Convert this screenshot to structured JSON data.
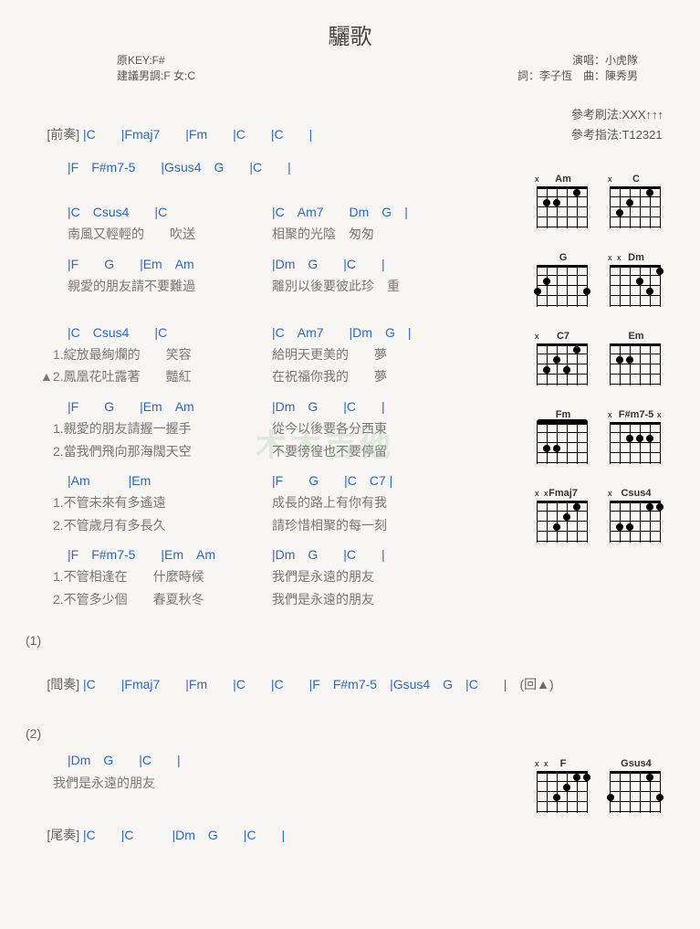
{
  "title": "驪歌",
  "meta": {
    "original_key_label": "原KEY:F#",
    "suggested_key_label": "建議男調:F 女:C",
    "singer_label": "演唱：小虎隊",
    "credits_label": "詞：李子恆　曲：陳秀男"
  },
  "reference": {
    "strum_label": "參考刷法:XXX↑↑↑",
    "finger_label": "參考指法:T12321"
  },
  "intro": {
    "label": "[前奏]",
    "line1": "|C　　|Fmaj7　　|Fm　　|C　　|C　　|",
    "line2": "|F　F#m7-5　　|Gsus4　G　　|C　　|"
  },
  "verse1": {
    "chords_a": "|C　Csus4　　|C",
    "chords_b": "|C　Am7　　Dm　G　|",
    "lyric_a": "南風又輕輕的　　吹送",
    "lyric_b": "相聚的光陰　匆匆",
    "chords_c": "|F　　G　　|Em　Am",
    "chords_d": "|Dm　G　　|C　　|",
    "lyric_c": "親愛的朋友請不要難過",
    "lyric_d": "離別以後要彼此珍　重"
  },
  "verse2": {
    "chords_a": "|C　Csus4　　|C",
    "chords_b": "|C　Am7　　|Dm　G　|",
    "lyric_1a": "1.綻放最絢爛的　　笑容",
    "lyric_1b": "給明天更美的　　夢",
    "lyric_2a": "▲2.鳳凰花吐露著　　豔紅",
    "lyric_2b": "在祝福你我的　　夢",
    "chords_c": "|F　　G　　|Em　Am",
    "chords_d": "|Dm　G　　|C　　|",
    "lyric_1c": "1.親愛的朋友請握一握手",
    "lyric_1d": "從今以後要各分西東",
    "lyric_2c": "2.當我們飛向那海闊天空",
    "lyric_2d": "不要徬徨也不要停留",
    "chords_e": "|Am　　　|Em",
    "chords_f": "|F　　G　　|C　C7 |",
    "lyric_1e": "1.不管未來有多遙遠",
    "lyric_1f": "成長的路上有你有我",
    "lyric_2e": "2.不管歲月有多長久",
    "lyric_2f": "請珍惜相聚的每一刻",
    "chords_g": "|F　F#m7-5　　|Em　Am",
    "chords_h": "|Dm　G　　|C　　|",
    "lyric_1g": "1.不管相逢在　　什麼時候",
    "lyric_1h": "我們是永遠的朋友",
    "lyric_2g": "2.不管多少個　　春夏秋冬",
    "lyric_2h": "我們是永遠的朋友"
  },
  "inter": {
    "label1": "(1)",
    "inter_label": "[間奏]",
    "inter_line": "|C　　|Fmaj7　　|Fm　　|C　　|C　　|F　F#m7-5　|Gsus4　G　|C　　|",
    "back_label": "(回▲)"
  },
  "ending": {
    "label2": "(2)",
    "chords": "|Dm　G　　|C　　|",
    "lyric": "我們是永遠的朋友",
    "outro_label": "[尾奏]",
    "outro_line": "|C　　|C　　　|Dm　G　　|C　　|"
  },
  "chord_names": {
    "Am": "Am",
    "C": "C",
    "G": "G",
    "Dm": "Dm",
    "C7": "C7",
    "Em": "Em",
    "Fm": "Fm",
    "Fsharpm75": "F#m7-5",
    "Fmaj7": "Fmaj7",
    "Csus4": "Csus4",
    "F": "F",
    "Gsus4": "Gsus4"
  },
  "watermark": "木木吉他"
}
